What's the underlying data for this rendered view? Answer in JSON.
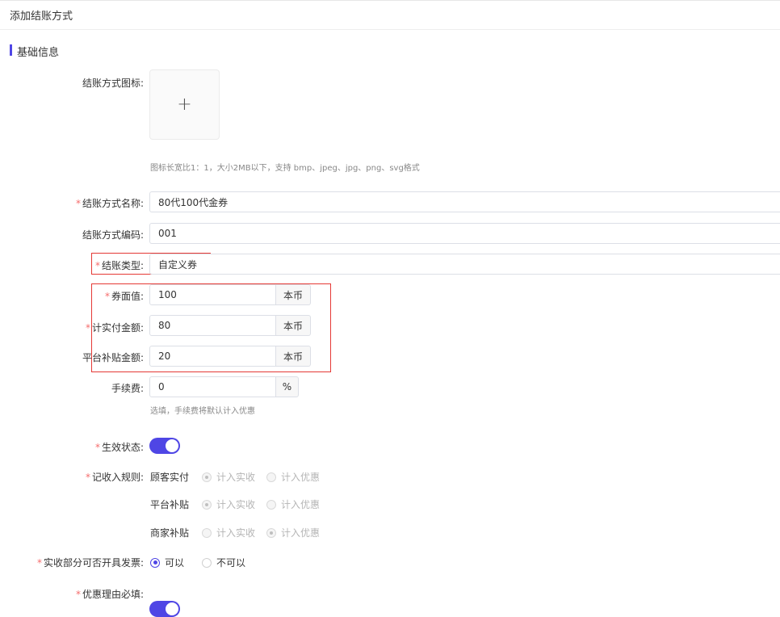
{
  "page": {
    "title": "添加结账方式"
  },
  "section": {
    "title": "基础信息"
  },
  "icon_field": {
    "label": "结账方式图标:",
    "upload_symbol": "+",
    "hint": "图标长宽比1：1，大小2MB以下，支持 bmp、jpeg、jpg、png、svg格式"
  },
  "name_field": {
    "label": "结账方式名称:",
    "value": "80代100代金券",
    "required": true
  },
  "code_field": {
    "label": "结账方式编码:",
    "value": "001",
    "required": false
  },
  "type_field": {
    "label": "结账类型:",
    "value": "自定义券",
    "required": true
  },
  "face_value_field": {
    "label": "券面值:",
    "value": "100",
    "unit": "本币",
    "required": true
  },
  "actual_pay_field": {
    "label": "计实付金额:",
    "value": "80",
    "unit": "本币",
    "required": true
  },
  "platform_subsidy_field": {
    "label": "平台补贴金额:",
    "value": "20",
    "unit": "本币",
    "required": false
  },
  "fee_field": {
    "label": "手续费:",
    "value": "0",
    "unit": "%",
    "hint": "选填，手续费将默认计入优惠",
    "required": false
  },
  "status_field": {
    "label": "生效状态:",
    "on": true,
    "required": true
  },
  "income_rule": {
    "label": "记收入规则:",
    "rows": [
      {
        "name": "顾客实付",
        "option_a": "计入实收",
        "option_b": "计入优惠",
        "selected": "a"
      },
      {
        "name": "平台补贴",
        "option_a": "计入实收",
        "option_b": "计入优惠",
        "selected": "a"
      },
      {
        "name": "商家补贴",
        "option_a": "计入实收",
        "option_b": "计入优惠",
        "selected": "b"
      }
    ]
  },
  "invoice_field": {
    "label": "实收部分可否开具发票:",
    "option_yes": "可以",
    "option_no": "不可以",
    "selected": "yes"
  },
  "reason_field": {
    "label": "优惠理由必填:",
    "on": true
  },
  "colors": {
    "accent": "#4f46e5",
    "required_star": "#f56c6c",
    "highlight_box": "#e53935"
  }
}
